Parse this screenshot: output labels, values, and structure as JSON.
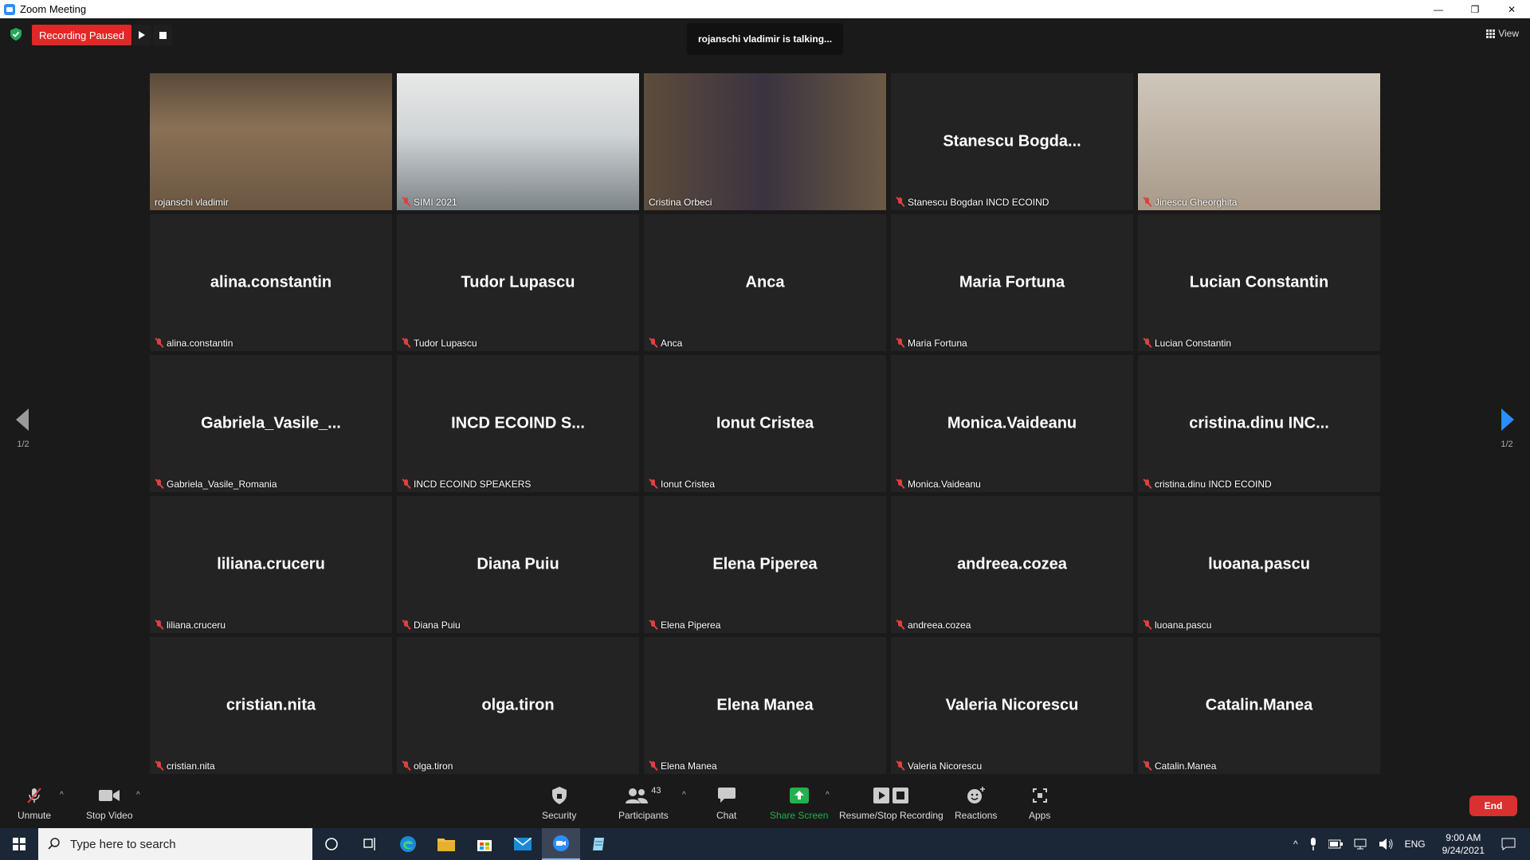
{
  "window": {
    "title": "Zoom Meeting",
    "minimize": "—",
    "restore": "❐",
    "close": "✕"
  },
  "topbar": {
    "recording_status": "Recording Paused",
    "talking_banner": "rojanschi vladimir is talking...",
    "view_label": "View"
  },
  "participants": [
    {
      "big": "",
      "label": "rojanschi vladimir",
      "muted": false,
      "video": "v1",
      "active": true
    },
    {
      "big": "",
      "label": "SIMI 2021",
      "muted": true,
      "video": "v2",
      "active": false
    },
    {
      "big": "",
      "label": "Cristina Orbeci",
      "muted": false,
      "video": "v3",
      "active": false
    },
    {
      "big": "Stanescu  Bogda...",
      "label": "Stanescu Bogdan INCD ECOIND",
      "muted": true,
      "video": "",
      "active": false
    },
    {
      "big": "",
      "label": "Jinescu Gheorghita",
      "muted": true,
      "video": "v5",
      "active": false
    },
    {
      "big": "alina.constantin",
      "label": "alina.constantin",
      "muted": true,
      "video": "",
      "active": false
    },
    {
      "big": "Tudor  Lupascu",
      "label": "Tudor  Lupascu",
      "muted": true,
      "video": "",
      "active": false
    },
    {
      "big": "Anca",
      "label": "Anca",
      "muted": true,
      "video": "",
      "active": false
    },
    {
      "big": "Maria Fortuna",
      "label": "Maria Fortuna",
      "muted": true,
      "video": "",
      "active": false
    },
    {
      "big": "Lucian Constantin",
      "label": "Lucian Constantin",
      "muted": true,
      "video": "",
      "active": false
    },
    {
      "big": "Gabriela_Vasile_...",
      "label": "Gabriela_Vasile_Romania",
      "muted": true,
      "video": "",
      "active": false
    },
    {
      "big": "INCD ECOIND S...",
      "label": "INCD ECOIND SPEAKERS",
      "muted": true,
      "video": "",
      "active": false
    },
    {
      "big": "Ionut Cristea",
      "label": "Ionut Cristea",
      "muted": true,
      "video": "",
      "active": false
    },
    {
      "big": "Monica.Vaideanu",
      "label": "Monica.Vaideanu",
      "muted": true,
      "video": "",
      "active": false
    },
    {
      "big": "cristina.dinu  INC...",
      "label": "cristina.dinu INCD ECOIND",
      "muted": true,
      "video": "",
      "active": false
    },
    {
      "big": "liliana.cruceru",
      "label": "liliana.cruceru",
      "muted": true,
      "video": "",
      "active": false
    },
    {
      "big": "Diana Puiu",
      "label": "Diana Puiu",
      "muted": true,
      "video": "",
      "active": false
    },
    {
      "big": "Elena Piperea",
      "label": "Elena Piperea",
      "muted": true,
      "video": "",
      "active": false
    },
    {
      "big": "andreea.cozea",
      "label": "andreea.cozea",
      "muted": true,
      "video": "",
      "active": false
    },
    {
      "big": "luoana.pascu",
      "label": "luoana.pascu",
      "muted": true,
      "video": "",
      "active": false
    },
    {
      "big": "cristian.nita",
      "label": "cristian.nita",
      "muted": true,
      "video": "",
      "active": false
    },
    {
      "big": "olga.tiron",
      "label": "olga.tiron",
      "muted": true,
      "video": "",
      "active": false
    },
    {
      "big": "Elena Manea",
      "label": "Elena Manea",
      "muted": true,
      "video": "",
      "active": false
    },
    {
      "big": "Valeria Nicorescu",
      "label": "Valeria Nicorescu",
      "muted": true,
      "video": "",
      "active": false
    },
    {
      "big": "Catalin.Manea",
      "label": "Catalin.Manea",
      "muted": true,
      "video": "",
      "active": false
    }
  ],
  "pager": {
    "left": "1/2",
    "right": "1/2"
  },
  "toolbar": {
    "unmute": "Unmute",
    "stop_video": "Stop Video",
    "security": "Security",
    "participants": "Participants",
    "participant_count": "43",
    "chat": "Chat",
    "share_screen": "Share Screen",
    "resume_stop_recording": "Resume/Stop Recording",
    "reactions": "Reactions",
    "apps": "Apps",
    "end": "End"
  },
  "taskbar": {
    "search_placeholder": "Type here to search",
    "language": "ENG",
    "time": "9:00 AM",
    "date": "9/24/2021"
  },
  "colors": {
    "accent_red": "#e02828",
    "share_green": "#22b14c",
    "speaker_highlight": "#e6f03a"
  }
}
